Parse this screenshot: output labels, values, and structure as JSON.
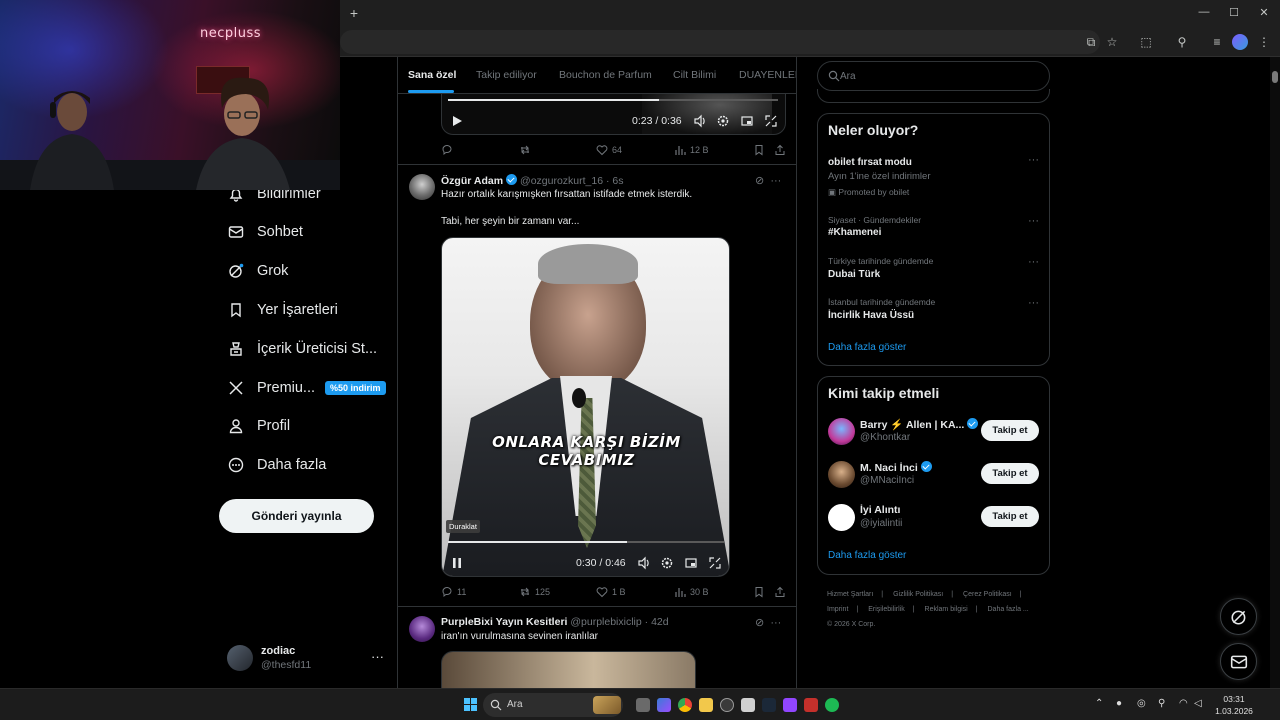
{
  "browser": {
    "new_tab": "+",
    "minimize": "—",
    "maximize": "☐",
    "close": "✕"
  },
  "stream": {
    "logo": "necpluss"
  },
  "nav": {
    "items": [
      {
        "label": "Bildirimler",
        "icon": "bell-icon"
      },
      {
        "label": "Sohbet",
        "icon": "mail-icon"
      },
      {
        "label": "Grok",
        "icon": "grok-icon"
      },
      {
        "label": "Yer İşaretleri",
        "icon": "bookmark-icon"
      },
      {
        "label": "İçerik Üreticisi St...",
        "icon": "creator-studio-icon"
      },
      {
        "label": "Premiu...",
        "icon": "x-logo-icon",
        "badge": "%50 indirim"
      },
      {
        "label": "Profil",
        "icon": "profile-icon"
      },
      {
        "label": "Daha fazla",
        "icon": "more-circle-icon"
      }
    ],
    "post_button": "Gönderi yayınla",
    "account": {
      "name": "zodiac",
      "handle": "@thesfd11",
      "more": "···"
    }
  },
  "timeline": {
    "tabs": [
      "Sana özel",
      "Takip ediliyor",
      "Bouchon de Parfum",
      "Cilt Bilimi",
      "DUAYENLER"
    ],
    "active_tab": "Sana özel",
    "top_video": {
      "time": "0:23 / 0:36",
      "progress": 0.64
    },
    "top_actions": {
      "replies": "",
      "reposts": "",
      "likes": "64",
      "views": "12 B"
    },
    "tweets": [
      {
        "name": "Özgür Adam",
        "handle": "@ozgurozkurt_16",
        "time": "· 6s",
        "line1": "Hazır ortalık karışmışken fırsattan istifade etmek isterdik.",
        "line2": "Tabi, her şeyin bir zamanı var...",
        "video": {
          "caption": "ONLARA KARŞI BİZİM CEVABIMIZ",
          "tooltip": "Duraklat",
          "time": "0:30 / 0:46",
          "progress": 0.65
        },
        "actions": {
          "replies": "11",
          "reposts": "125",
          "likes": "1 B",
          "views": "30 B"
        }
      },
      {
        "name": "PurpleBixi Yayın Kesitleri",
        "handle": "@purplebixiclip",
        "time": "· 42d",
        "line1": "iran'ın vurulmasına sevinen iranlılar"
      }
    ]
  },
  "sidebar": {
    "search_placeholder": "Ara",
    "trends_title": "Neler oluyor?",
    "trends": [
      {
        "category": "",
        "title": "obilet fırsat modu",
        "sub": "Ayın 1'ine özel indirimler",
        "promo": "Promoted by obilet"
      },
      {
        "category": "Siyaset · Gündemdekiler",
        "title": "#Khamenei"
      },
      {
        "category": "Türkiye tarihinde gündemde",
        "title": "Dubai Türk"
      },
      {
        "category": "İstanbul tarihinde gündemde",
        "title": "İncirlik Hava Üssü"
      }
    ],
    "trends_more": "Daha fazla göster",
    "wtf_title": "Kimi takip etmeli",
    "follow_label": "Takip et",
    "suggestions": [
      {
        "name": "Barry ⚡ Allen | KA...",
        "handle": "@Khontkar"
      },
      {
        "name": "M. Naci İnci",
        "handle": "@MNaciInci"
      },
      {
        "name": "İyi Alıntı",
        "handle": "@iyialintii"
      }
    ],
    "wtf_more": "Daha fazla göster",
    "footer": [
      "Hizmet Şartları",
      "|",
      "Gizlilik Politikası",
      "|",
      "Çerez Politikası",
      "|",
      "Imprint",
      "|",
      "Erişilebilirlik",
      "|",
      "Reklam bilgisi",
      "|",
      "Daha fazla ...",
      "© 2026 X Corp."
    ]
  },
  "taskbar": {
    "search_placeholder": "Ara",
    "time": "03:31",
    "date": "1.03.2026"
  }
}
